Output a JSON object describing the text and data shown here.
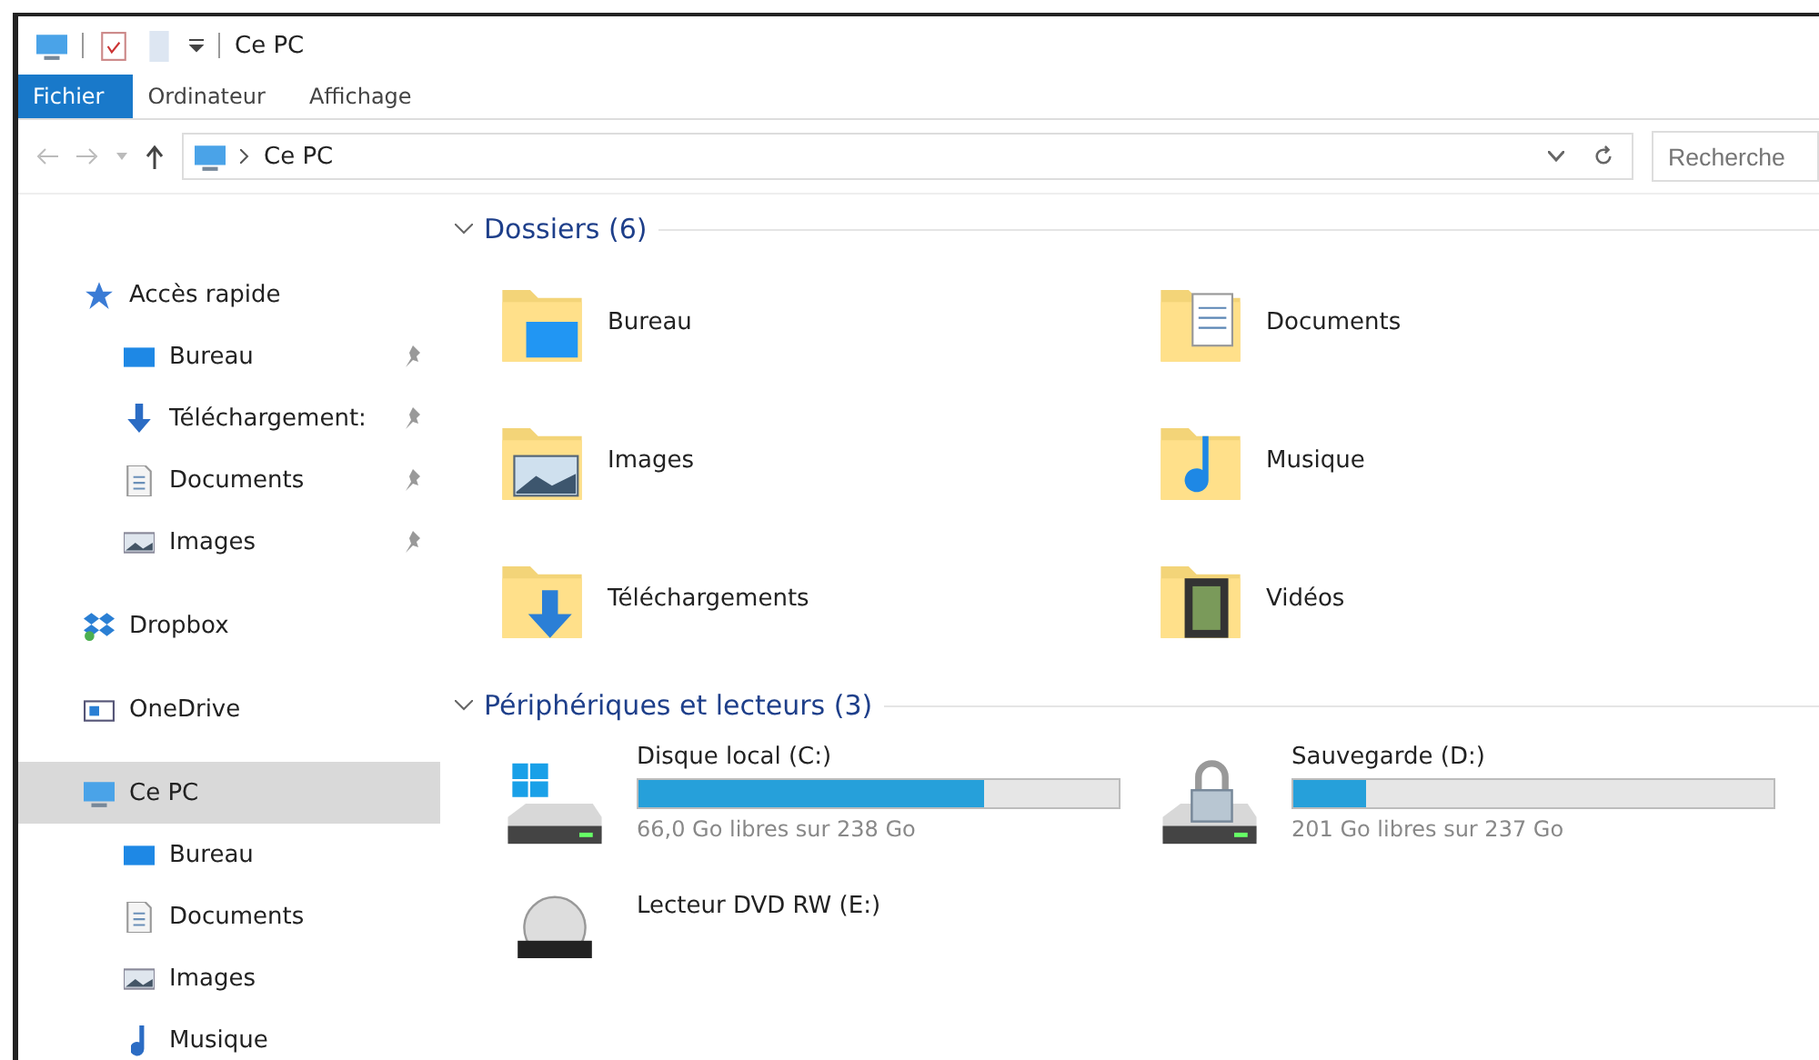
{
  "window": {
    "title": "Ce PC"
  },
  "ribbon_tabs": [
    {
      "label": "Fichier",
      "selected": true
    },
    {
      "label": "Ordinateur",
      "selected": false
    },
    {
      "label": "Affichage",
      "selected": false
    }
  ],
  "address_bar": {
    "path": "Ce PC",
    "search_placeholder": "Recherche"
  },
  "sidebar": {
    "items": [
      {
        "kind": "star",
        "label": "Accès rapide",
        "pinned": false,
        "selected": false,
        "children": [
          {
            "kind": "desktop",
            "label": "Bureau",
            "pinned": true,
            "selected": false
          },
          {
            "kind": "download",
            "label": "Téléchargement:",
            "pinned": true,
            "selected": false
          },
          {
            "kind": "document",
            "label": "Documents",
            "pinned": true,
            "selected": false
          },
          {
            "kind": "image",
            "label": "Images",
            "pinned": true,
            "selected": false
          }
        ]
      },
      {
        "kind": "dropbox",
        "label": "Dropbox",
        "pinned": false,
        "selected": false
      },
      {
        "kind": "onedrive",
        "label": "OneDrive",
        "pinned": false,
        "selected": false
      },
      {
        "kind": "pc",
        "label": "Ce PC",
        "pinned": false,
        "selected": true,
        "children": [
          {
            "kind": "desktop",
            "label": "Bureau",
            "pinned": false,
            "selected": false
          },
          {
            "kind": "document",
            "label": "Documents",
            "pinned": false,
            "selected": false
          },
          {
            "kind": "image",
            "label": "Images",
            "pinned": false,
            "selected": false
          },
          {
            "kind": "music",
            "label": "Musique",
            "pinned": false,
            "selected": false
          }
        ]
      }
    ]
  },
  "folders": {
    "heading": "Dossiers (6)",
    "items": [
      {
        "kind": "desktop",
        "label": "Bureau"
      },
      {
        "kind": "document",
        "label": "Documents"
      },
      {
        "kind": "image",
        "label": "Images"
      },
      {
        "kind": "music",
        "label": "Musique"
      },
      {
        "kind": "download",
        "label": "Téléchargements"
      },
      {
        "kind": "video",
        "label": "Vidéos"
      }
    ]
  },
  "drives": {
    "heading": "Périphériques et lecteurs (3)",
    "items": [
      {
        "kind": "windows",
        "label": "Disque local (C:)",
        "level": 0.72,
        "free": "66,0 Go libres sur 238 Go"
      },
      {
        "kind": "lock",
        "label": "Sauvegarde (D:)",
        "level": 0.15,
        "free": "201 Go libres sur 237 Go"
      },
      {
        "kind": "dvd",
        "label": "Lecteur DVD RW (E:)"
      }
    ]
  }
}
